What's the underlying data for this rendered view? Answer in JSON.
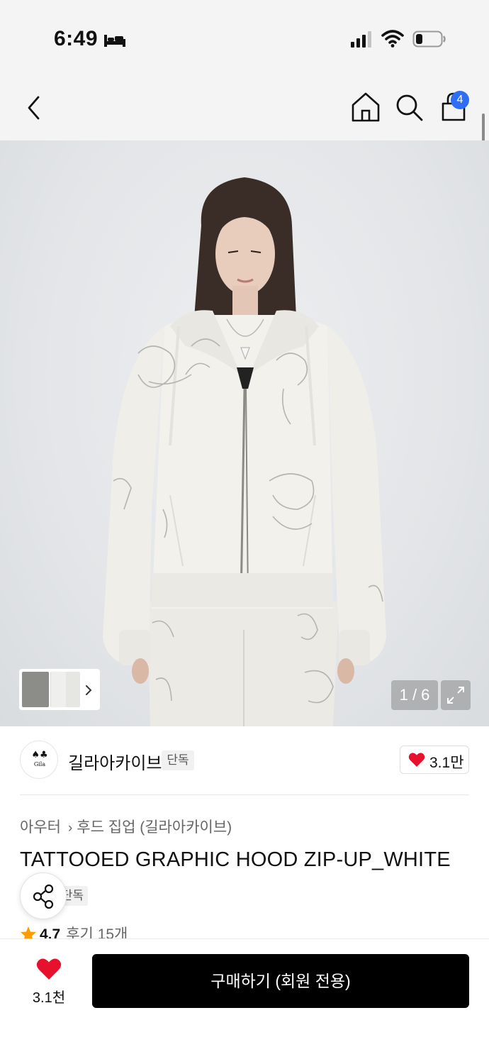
{
  "status_bar": {
    "time": "6:49"
  },
  "nav": {
    "cart_badge": "4"
  },
  "gallery": {
    "counter": "1 / 6",
    "colors": {
      "background": "#e3e5e8",
      "hoodie": "#f2f1ec",
      "hair": "#3a2c26"
    }
  },
  "brand": {
    "logo_mark": "♠♣",
    "logo_text": "Gila",
    "name": "길라아카이브",
    "badge": "단독",
    "like_count": "3.1만"
  },
  "product": {
    "breadcrumb": [
      "아우터",
      "후드 집업 (길라아카이브)"
    ],
    "title": "TATTOOED GRAPHIC HOOD ZIP-UP_WHITE",
    "exclusive_badge": "단독",
    "rating": "4.7",
    "reviews": "후기 15개"
  },
  "bottom_bar": {
    "like_count": "3.1천",
    "buy_label": "구매하기 (회원 전용)"
  },
  "theme": {
    "accent": "#2e6df6",
    "heart": "#e8112d",
    "star": "#ff9d00",
    "buy_button": "#000000"
  }
}
